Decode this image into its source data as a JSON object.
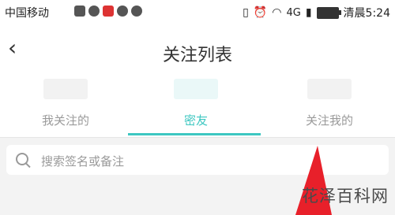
{
  "statusbar": {
    "carrier": "中国移动",
    "network": "4G",
    "time": "清晨5:24"
  },
  "header": {
    "back_label": "‹",
    "title": "关注列表"
  },
  "tabs": [
    {
      "label": "我关注的"
    },
    {
      "label": "密友"
    },
    {
      "label": "关注我的"
    }
  ],
  "search": {
    "placeholder": "搜索签名或备注"
  },
  "watermark": "花泽百科网",
  "colors": {
    "accent": "#3dc7c1",
    "annotation_arrow": "#e8202a"
  },
  "icons": [
    "back-icon",
    "search-icon",
    "vibrate-icon",
    "alarm-icon",
    "wifi-icon",
    "signal-icon",
    "battery-icon"
  ]
}
